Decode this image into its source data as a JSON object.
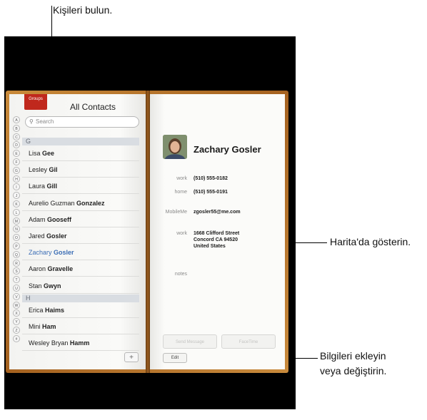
{
  "callouts": {
    "find_contacts": "Kişileri bulun.",
    "show_in_maps": "Harita'da gösterin.",
    "add_or_edit_line1": "Bilgileri ekleyin",
    "add_or_edit_line2": "veya değiştirin."
  },
  "left_page": {
    "groups_label": "Groups",
    "title": "All Contacts",
    "search_placeholder": "Search",
    "add_label": "+",
    "index_letters": [
      "A",
      "B",
      "C",
      "D",
      "E",
      "F",
      "G",
      "H",
      "I",
      "J",
      "K",
      "L",
      "M",
      "N",
      "O",
      "P",
      "Q",
      "R",
      "S",
      "T",
      "U",
      "V",
      "W",
      "X",
      "Y",
      "Z",
      "#"
    ],
    "sections": [
      {
        "header": "G",
        "contacts": [
          {
            "first": "Lisa",
            "last": "Gee",
            "selected": false
          },
          {
            "first": "Lesley",
            "last": "Gil",
            "selected": false
          },
          {
            "first": "Laura",
            "last": "Gill",
            "selected": false
          },
          {
            "first": "Aurelio Guzman",
            "last": "Gonzalez",
            "selected": false
          },
          {
            "first": "Adam",
            "last": "Gooseff",
            "selected": false
          },
          {
            "first": "Jared",
            "last": "Gosler",
            "selected": false
          },
          {
            "first": "Zachary",
            "last": "Gosler",
            "selected": true
          },
          {
            "first": "Aaron",
            "last": "Gravelle",
            "selected": false
          },
          {
            "first": "Stan",
            "last": "Gwyn",
            "selected": false
          }
        ]
      },
      {
        "header": "H",
        "contacts": [
          {
            "first": "Erica",
            "last": "Haims",
            "selected": false
          },
          {
            "first": "Mini",
            "last": "Ham",
            "selected": false
          },
          {
            "first": "Wesley Bryan",
            "last": "Hamm",
            "selected": false
          }
        ]
      }
    ]
  },
  "right_page": {
    "name": "Zachary Gosler",
    "fields": {
      "work_phone_label": "work",
      "work_phone": "(510) 555-0182",
      "home_phone_label": "home",
      "home_phone": "(510) 555-0191",
      "mobileme_label": "MobileMe",
      "mobileme": "zgosler55@me.com",
      "work_address_label": "work",
      "address_line1": "1668 Clifford Street",
      "address_line2": "Concord CA 94520",
      "address_line3": "United States",
      "notes_label": "notes"
    },
    "send_message_label": "Send Message",
    "facetime_label": "FaceTime",
    "edit_label": "Edit"
  },
  "colors": {
    "selected_contact": "#3b6db5",
    "groups_ribbon": "#c0281d",
    "book_cover": "#b06a25"
  }
}
